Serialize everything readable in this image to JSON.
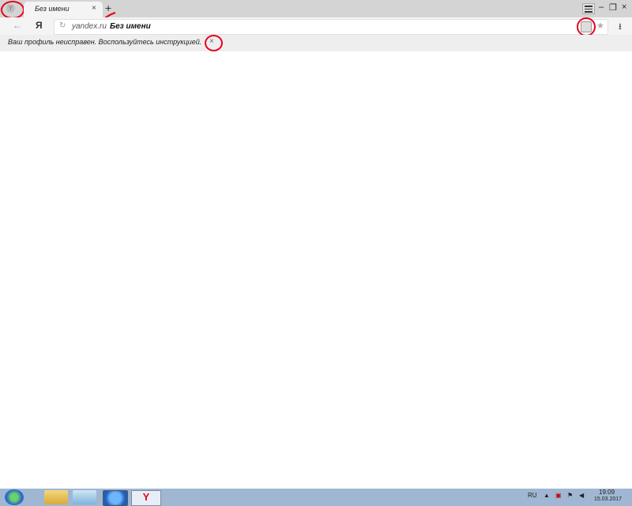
{
  "window": {
    "logo_glyph": "Y",
    "tab_title": "Без имени",
    "tab_close": "×",
    "new_tab": "+",
    "menu_icon": "hamburger-menu-icon",
    "minimize": "–",
    "restore": "❐",
    "close": "×"
  },
  "toolbar": {
    "back": "←",
    "yandex_button": "Я",
    "reload_icon": "↻",
    "url_domain": "yandex.ru",
    "url_title": "Без имени",
    "bookmark_icon": "★",
    "download_icon": "⭳"
  },
  "infobar": {
    "message": "Ваш профиль неисправен. Воспользуйтесь инструкцией.",
    "close": "×"
  },
  "taskbar": {
    "yandex_glyph": "Y",
    "language": "RU",
    "clock_time": "19:09",
    "clock_date": "15.03.2017"
  },
  "colors": {
    "annotation": "#e8001c",
    "taskbar": "#9fb7d3"
  }
}
